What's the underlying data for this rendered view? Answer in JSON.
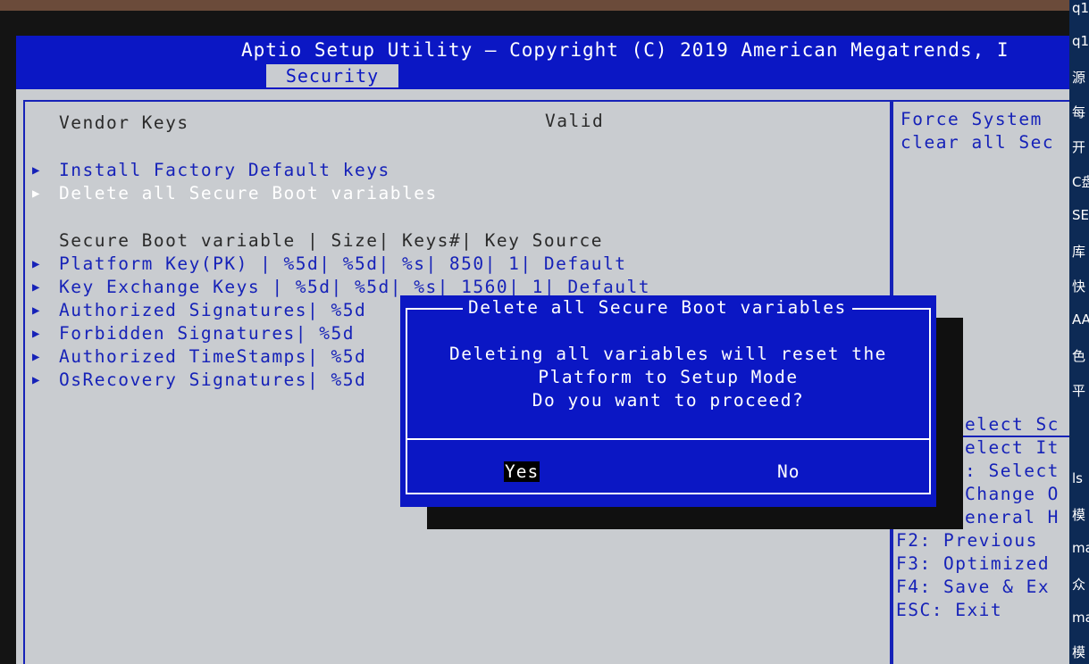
{
  "header": {
    "title": "Aptio Setup Utility – Copyright (C) 2019 American Megatrends, I",
    "tab": "Security"
  },
  "main": {
    "vendor_keys_label": "Vendor Keys",
    "vendor_keys_value": "Valid",
    "actions": [
      {
        "label": "Install Factory Default keys"
      },
      {
        "label": "Delete all Secure Boot variables"
      }
    ],
    "table_header": "Secure Boot variable |  Size| Keys#| Key Source",
    "rows": [
      {
        "text": "Platform Key(PK)      | %5d| %5d| %s|  850|    1| Default"
      },
      {
        "text": "Key Exchange Keys     | %5d| %5d| %s| 1560|    1| Default"
      },
      {
        "text": "Authorized Signatures| %5d"
      },
      {
        "text": "Forbidden  Signatures| %5d"
      },
      {
        "text": "Authorized TimeStamps| %5d"
      },
      {
        "text": "OsRecovery Signatures| %5d"
      }
    ]
  },
  "help": {
    "description": [
      "Force System",
      "clear all Sec"
    ],
    "keys": [
      "elect Sc",
      "elect It",
      ": Select",
      "Change O",
      "eneral H",
      "F2: Previous",
      "F3: Optimized",
      "F4: Save & Ex",
      "ESC: Exit"
    ]
  },
  "dialog": {
    "title": "Delete all Secure Boot variables",
    "message": [
      "Deleting all variables will reset the",
      "Platform to Setup Mode",
      "Do you want to proceed?"
    ],
    "yes": "Yes",
    "no": "No"
  },
  "side_strip": [
    "q1",
    "q1",
    "源",
    "每",
    "开",
    "C盘",
    "SE",
    "库",
    "快",
    "AA",
    "色",
    "平",
    "ls",
    "模",
    "ma",
    "众",
    "ma",
    "模"
  ],
  "colors": {
    "bios_blue": "#0b17c4",
    "bios_gray": "#c9ccd0",
    "text_blue": "#1622b8",
    "text_dark": "#2a2a2a"
  }
}
